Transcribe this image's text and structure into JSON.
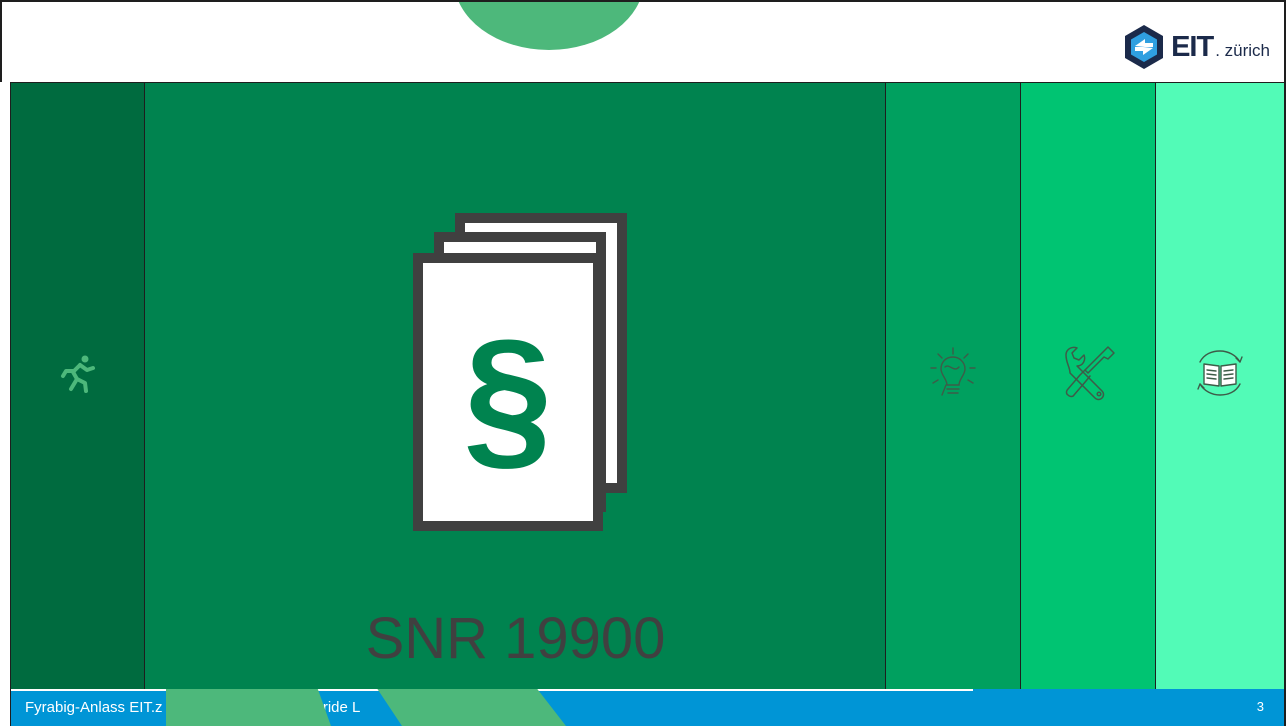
{
  "logo": {
    "brand": "EIT",
    "suffix": ". zürich"
  },
  "main": {
    "title": "SNR 19900",
    "symbol": "§"
  },
  "footer": {
    "text_left": "Fyrabig-Anlass EIT.z",
    "text_mid": "ybride L",
    "page_number": "3"
  },
  "icons": {
    "exit": "running-person-icon",
    "idea": "lightbulb-icon",
    "tools": "wrench-screwdriver-icon",
    "learn": "open-book-cycle-icon",
    "document": "law-document-stack-icon"
  },
  "colors": {
    "panel_exit": "#006b3f",
    "panel_main": "#00834f",
    "panel_idea": "#00a05f",
    "panel_tools": "#00c472",
    "panel_learn": "#52fbb7",
    "footer": "#0095d6",
    "accent_green": "#4db87b",
    "title_text": "#404040"
  }
}
